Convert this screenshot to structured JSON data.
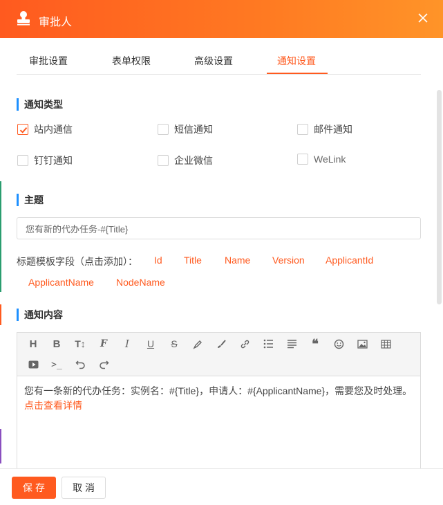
{
  "header": {
    "title": "审批人",
    "icon": "stamp-icon",
    "close_icon": "close-icon"
  },
  "tabs": [
    {
      "label": "审批设置",
      "active": false
    },
    {
      "label": "表单权限",
      "active": false
    },
    {
      "label": "高级设置",
      "active": false
    },
    {
      "label": "通知设置",
      "active": true
    }
  ],
  "notify_type": {
    "title": "通知类型",
    "options": [
      {
        "label": "站内通信",
        "checked": true
      },
      {
        "label": "短信通知",
        "checked": false
      },
      {
        "label": "邮件通知",
        "checked": false
      },
      {
        "label": "钉钉通知",
        "checked": false
      },
      {
        "label": "企业微信",
        "checked": false
      },
      {
        "label": "WeLink",
        "checked": false
      }
    ]
  },
  "subject": {
    "title": "主题",
    "value": "您有新的代办任务-#{Title}",
    "fields_label": "标题模板字段（点击添加）：",
    "fields": [
      "Id",
      "Title",
      "Name",
      "Version",
      "ApplicantId",
      "ApplicantName",
      "NodeName"
    ]
  },
  "content": {
    "title": "通知内容",
    "toolbar": [
      "heading-icon",
      "bold-icon",
      "text-size-icon",
      "font-icon",
      "italic-icon",
      "underline-icon",
      "strikethrough-icon",
      "highlighter-icon",
      "brush-icon",
      "link-icon",
      "bullet-list-icon",
      "align-icon",
      "quote-icon",
      "emoji-icon",
      "image-icon",
      "table-icon",
      "video-icon",
      "code-icon",
      "undo-icon",
      "redo-icon"
    ],
    "text": "您有一条新的代办任务：实例名：#{Title}，申请人：#{ApplicantName}，需要您及时处理。",
    "link": "点击查看详情"
  },
  "footer": {
    "save_label": "保存",
    "cancel_label": "取消"
  },
  "colors": {
    "accent": "#ff5a1f",
    "section_bar": "#1e90ff"
  }
}
